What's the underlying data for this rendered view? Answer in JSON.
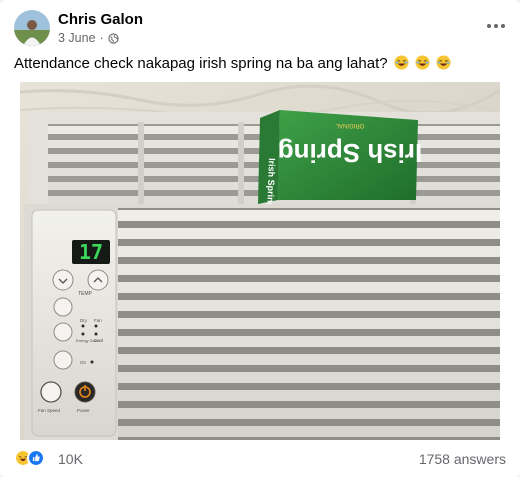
{
  "post": {
    "author": "Chris Galon",
    "date": "3 June",
    "separator": "·",
    "privacy_icon": "globe-icon",
    "caption": "Attendance check nakapag irish spring na ba ang lahat?",
    "caption_emojis": [
      "rolling-on-floor-laughing",
      "rolling-on-floor-laughing",
      "rolling-on-floor-laughing"
    ],
    "more_icon": "more-options-icon"
  },
  "photo": {
    "display_reading": "17",
    "soap_brand": "Irish Spring",
    "soap_side_brand": "Irish Spring",
    "soap_tag": "ORIGINAL",
    "labels": {
      "temp": "TEMP",
      "dry": "Dry",
      "fan": "Fan",
      "energy_saver": "Energy Saver",
      "cool": "Cool",
      "on": "On",
      "fan_speed": "Fan Speed",
      "power": "Power"
    },
    "colors": {
      "soap_green": "#2e8a3c",
      "display_green": "#3bd75a",
      "power_orange": "#e8861c"
    }
  },
  "footer": {
    "reaction_icons": [
      "haha-reaction-icon",
      "like-reaction-icon"
    ],
    "reaction_count": "10K",
    "answers": "1758 answers"
  }
}
